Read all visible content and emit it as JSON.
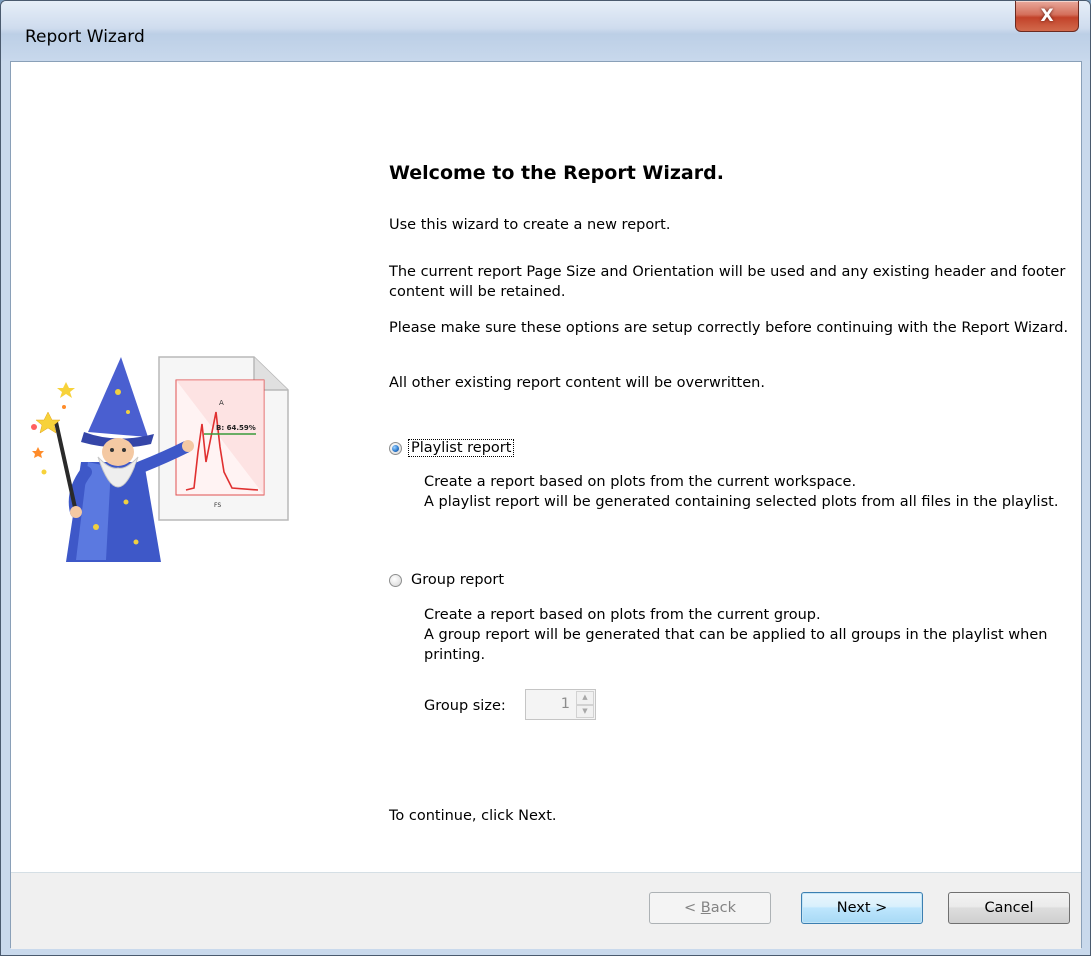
{
  "window": {
    "title": "Report Wizard",
    "close_glyph": "X"
  },
  "content": {
    "heading": "Welcome to the Report Wizard.",
    "intro": "Use this wizard to create a new report.",
    "page_size_note": "The current report Page Size and Orientation will be used and any existing header and footer content will be retained.",
    "options_note": "Please make sure these options are setup correctly before continuing with the Report Wizard.",
    "overwrite_note": "All other existing report content will be overwritten.",
    "continue_note": "To continue, click Next."
  },
  "options": {
    "playlist": {
      "label": "Playlist report",
      "checked": true,
      "description_1": "Create a report based on plots from the current workspace.",
      "description_2": "A playlist report will be generated containing selected plots from all files in the playlist."
    },
    "group": {
      "label": "Group report",
      "checked": false,
      "description_1": "Create a report based on plots from the current group.",
      "description_2": "A group report will be generated that can be applied to all groups in the playlist when printing.",
      "group_size_label": "Group size:",
      "group_size_value": "1"
    }
  },
  "illustration": {
    "chart_label_a": "A",
    "chart_label_b": "B: 64.59%",
    "chart_label_fs": "FS"
  },
  "buttons": {
    "back_prefix": "< ",
    "back_key": "B",
    "back_rest": "ack",
    "next": "Next >",
    "cancel": "Cancel"
  },
  "colors": {
    "title_close": "#c2422a",
    "default_button_border": "#3c7fb1",
    "radio_fill": "#2f7dd0"
  }
}
